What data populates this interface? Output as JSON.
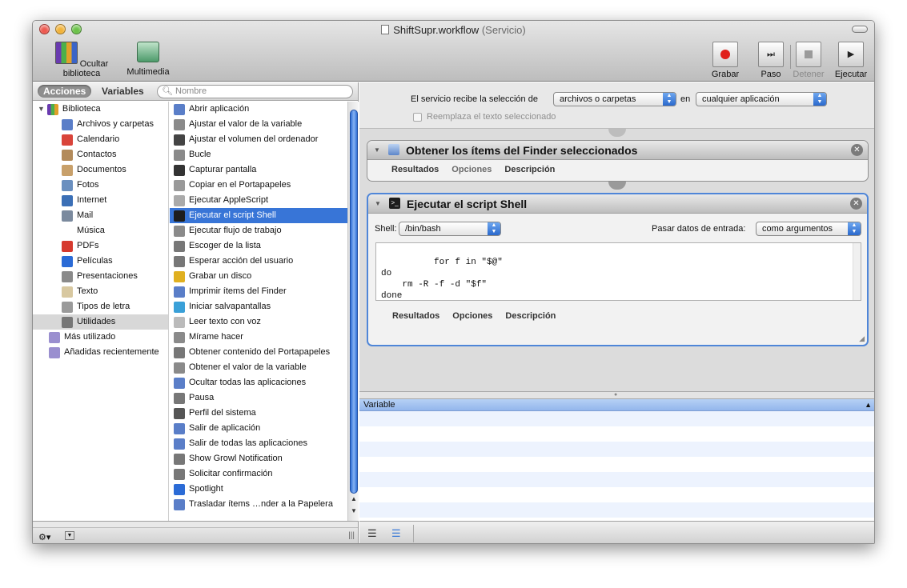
{
  "window": {
    "title": "ShiftSupr.workflow",
    "subtitle": "(Servicio)"
  },
  "toolbar": {
    "hide_library": "Ocultar biblioteca",
    "media": "Multimedia",
    "record": "Grabar",
    "step": "Paso",
    "stop": "Detener",
    "run": "Ejecutar"
  },
  "left_header": {
    "tab_actions": "Acciones",
    "tab_variables": "Variables",
    "search_placeholder": "Nombre"
  },
  "library": {
    "root": "Biblioteca",
    "categories": [
      {
        "label": "Archivos y carpetas",
        "icon": "folder-icon"
      },
      {
        "label": "Calendario",
        "icon": "calendar-icon"
      },
      {
        "label": "Contactos",
        "icon": "contacts-icon"
      },
      {
        "label": "Documentos",
        "icon": "document-icon"
      },
      {
        "label": "Fotos",
        "icon": "photos-icon"
      },
      {
        "label": "Internet",
        "icon": "internet-icon"
      },
      {
        "label": "Mail",
        "icon": "mail-icon"
      },
      {
        "label": "Música",
        "icon": "music-icon"
      },
      {
        "label": "PDFs",
        "icon": "pdf-icon"
      },
      {
        "label": "Películas",
        "icon": "movie-icon"
      },
      {
        "label": "Presentaciones",
        "icon": "presentation-icon"
      },
      {
        "label": "Texto",
        "icon": "text-icon"
      },
      {
        "label": "Tipos de letra",
        "icon": "font-icon"
      },
      {
        "label": "Utilidades",
        "icon": "utilities-icon"
      }
    ],
    "most_used": "Más utilizado",
    "recent": "Añadidas recientemente"
  },
  "actions": [
    "Abrir aplicación",
    "Ajustar el valor de la variable",
    "Ajustar el volumen del ordenador",
    "Bucle",
    "Capturar pantalla",
    "Copiar en el Portapapeles",
    "Ejecutar AppleScript",
    "Ejecutar el script Shell",
    "Ejecutar flujo de trabajo",
    "Escoger de la lista",
    "Esperar acción del usuario",
    "Grabar un disco",
    "Imprimir ítems del Finder",
    "Iniciar salvapantallas",
    "Leer texto con voz",
    "Mírame hacer",
    "Obtener contenido del Portapapeles",
    "Obtener el valor de la variable",
    "Ocultar todas las aplicaciones",
    "Pausa",
    "Perfil del sistema",
    "Salir de aplicación",
    "Salir de todas las aplicaciones",
    "Show Growl Notification",
    "Solicitar confirmación",
    "Spotlight",
    "Trasladar ítems …nder a la Papelera"
  ],
  "service": {
    "receives_label": "El servicio recibe la selección de",
    "receives_value": "archivos o carpetas",
    "in_label": "en",
    "in_value": "cualquier aplicación",
    "replace_label": "Reemplaza el texto seleccionado"
  },
  "cards": {
    "finder": {
      "title": "Obtener los ítems del Finder seleccionados",
      "tab_results": "Resultados",
      "tab_options": "Opciones",
      "tab_description": "Descripción"
    },
    "shell": {
      "title": "Ejecutar el script Shell",
      "shell_label": "Shell:",
      "shell_value": "/bin/bash",
      "input_label": "Pasar datos de entrada:",
      "input_value": "como argumentos",
      "code": "for f in \"$@\"\ndo\n    rm -R -f -d \"$f\"\ndone",
      "tab_results": "Resultados",
      "tab_options": "Opciones",
      "tab_description": "Descripción"
    }
  },
  "variables_panel": {
    "header": "Variable"
  }
}
